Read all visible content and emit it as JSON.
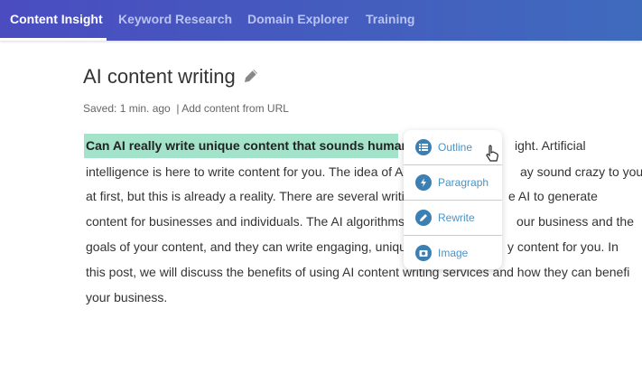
{
  "nav": {
    "tabs": [
      {
        "label": "Content Insight",
        "active": true
      },
      {
        "label": "Keyword Research"
      },
      {
        "label": "Domain Explorer"
      },
      {
        "label": "Training"
      }
    ]
  },
  "doc": {
    "title": "AI content writing",
    "saved": "Saved: 1 min. ago",
    "add_url": "| Add content from URL"
  },
  "body": {
    "highlight": "Can AI really write unique content that sounds human?",
    "lines": [
      {
        "left": "",
        "right": "ight. Artificial"
      },
      {
        "left": "intelligence is here to write content for you. The idea of A",
        "right": "ay sound crazy to you"
      },
      {
        "left": "at first, but this is already a reality. There are several writin",
        "right": "e AI to generate"
      },
      {
        "left": "content for businesses and individuals. The AI algorithms",
        "right": "our business and the"
      },
      {
        "left": "goals of your content, and they can write engaging, uniqu",
        "right": "y content for you. In"
      },
      {
        "left": "this post, we will discuss the benefits of using AI content writing services and how they can benefit",
        "right": ""
      },
      {
        "left": "your business.",
        "right": ""
      }
    ]
  },
  "popup": {
    "items": [
      {
        "label": "Outline",
        "icon": "list-icon"
      },
      {
        "label": "Paragraph",
        "icon": "lightning-icon"
      },
      {
        "label": "Rewrite",
        "icon": "pencil-icon"
      },
      {
        "label": "Image",
        "icon": "camera-icon"
      }
    ]
  },
  "colors": {
    "nav_start": "#4a4cc0",
    "nav_end": "#3f6bbd",
    "highlight": "#a3e3c9",
    "accent": "#3b7fb3"
  }
}
